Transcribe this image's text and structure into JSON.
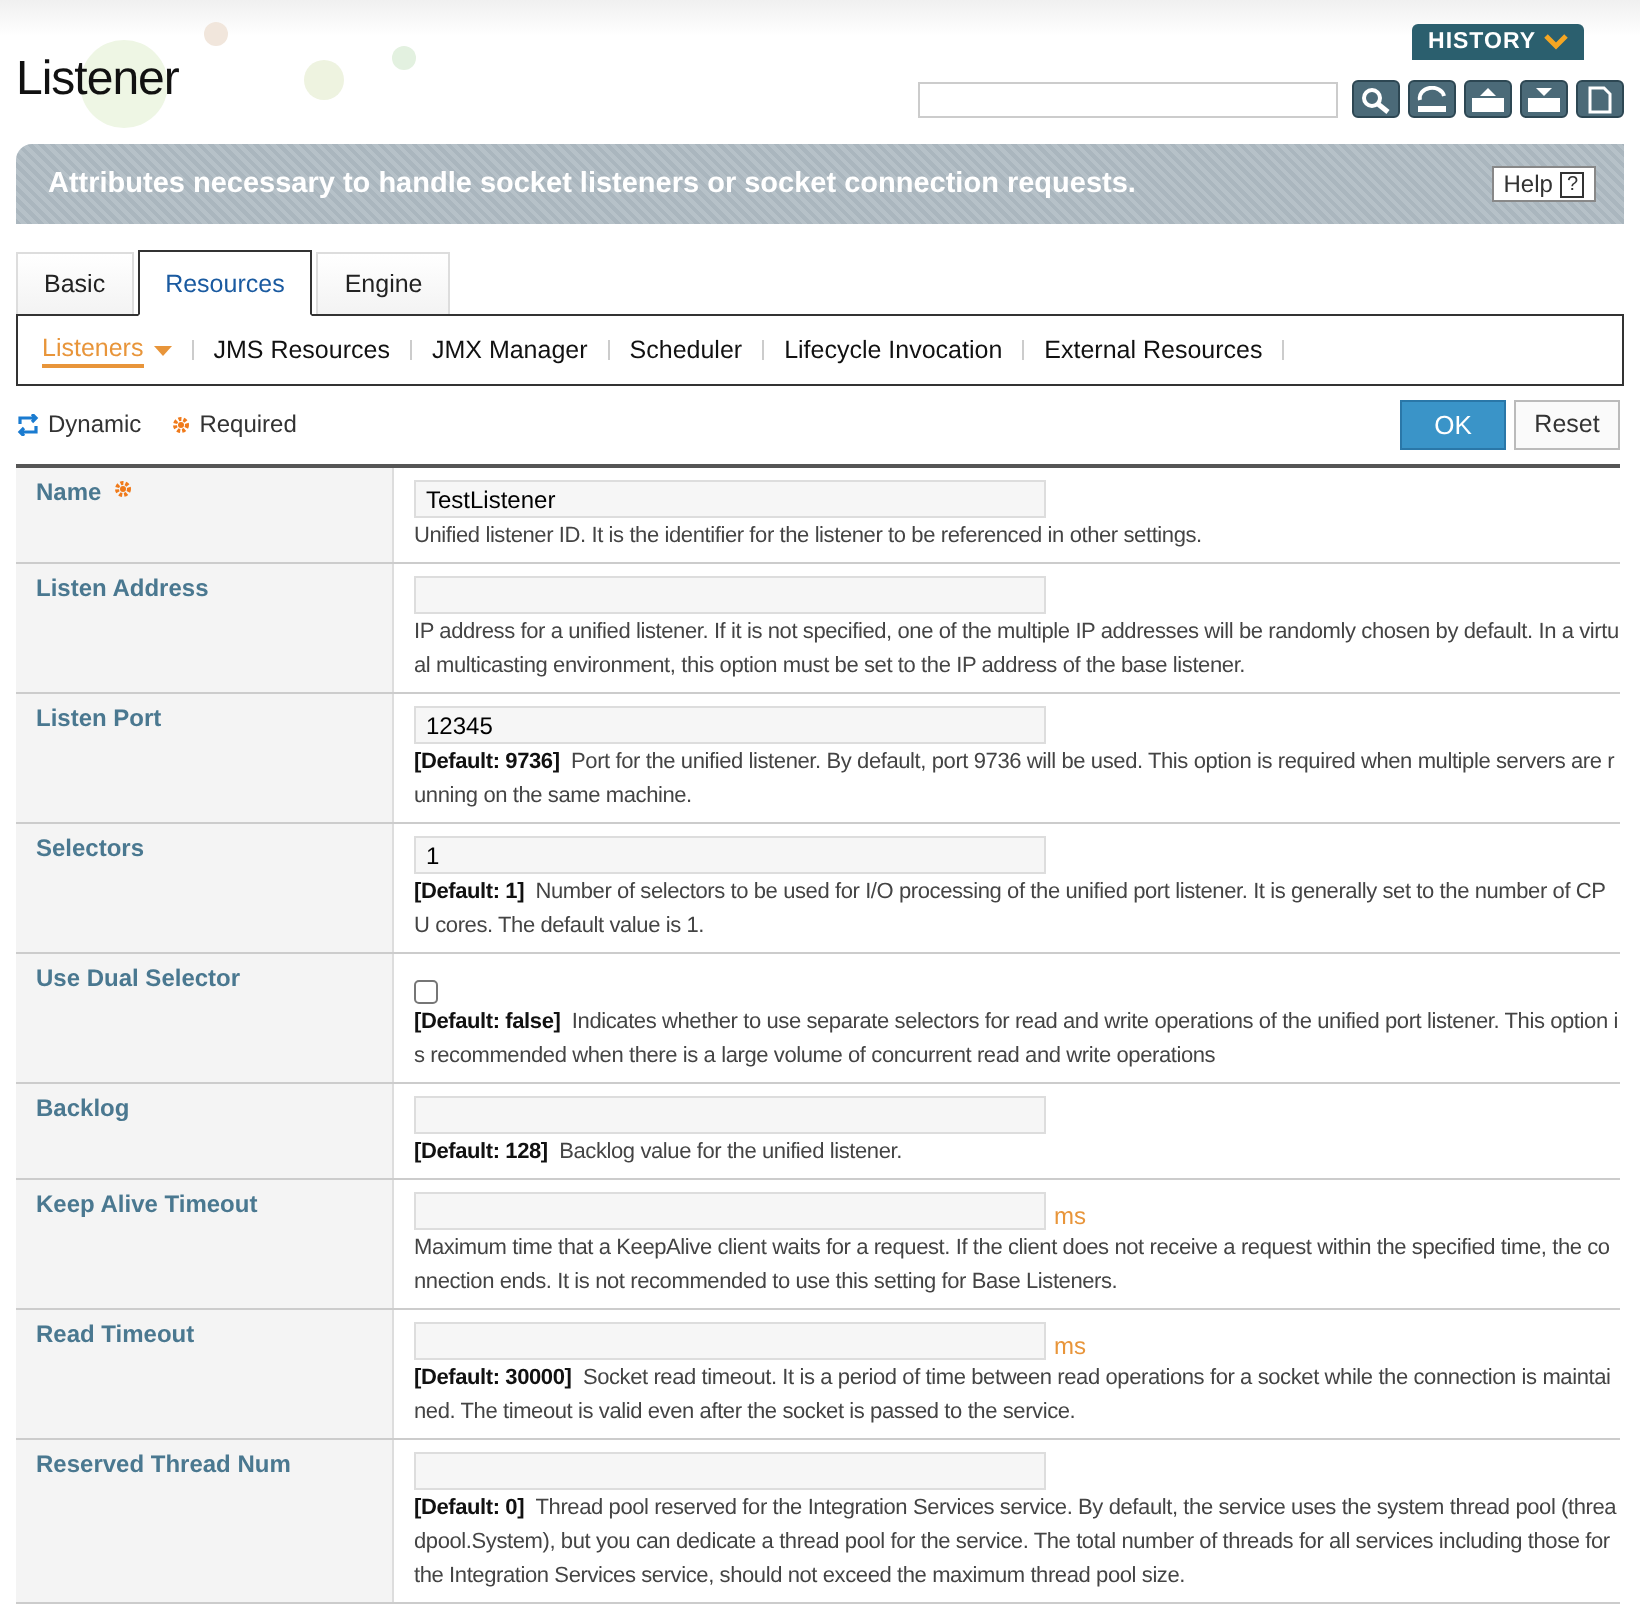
{
  "page": {
    "title": "Listener",
    "history_button": "HISTORY",
    "description": "Attributes necessary to handle socket listeners or socket connection requests.",
    "help_button": "Help",
    "help_glyph": "?"
  },
  "tabs": [
    {
      "label": "Basic",
      "selected": false
    },
    {
      "label": "Resources",
      "selected": true
    },
    {
      "label": "Engine",
      "selected": false
    }
  ],
  "subtabs": [
    {
      "label": "Listeners",
      "selected": true,
      "dropdown": true
    },
    {
      "label": "JMS Resources",
      "selected": false,
      "dropdown": false
    },
    {
      "label": "JMX Manager",
      "selected": false,
      "dropdown": false
    },
    {
      "label": "Scheduler",
      "selected": false,
      "dropdown": false
    },
    {
      "label": "Lifecycle Invocation",
      "selected": false,
      "dropdown": false
    },
    {
      "label": "External Resources",
      "selected": false,
      "dropdown": false
    }
  ],
  "legend": {
    "dynamic": "Dynamic",
    "required": "Required"
  },
  "buttons": {
    "ok": "OK",
    "reset": "Reset"
  },
  "fields": [
    {
      "label": "Name",
      "required": true,
      "kind": "text",
      "value": "TestListener",
      "description": "Unified listener ID. It is the identifier for the listener to be referenced in other settings."
    },
    {
      "label": "Listen Address",
      "required": false,
      "kind": "text",
      "description": "IP address for a unified listener. If it is not specified, one of the multiple IP addresses will be randomly chosen by default. In a virtual multicasting environment, this option must be set to the IP address of the base listener."
    },
    {
      "label": "Listen Port",
      "required": false,
      "kind": "text",
      "value": "12345",
      "default": "[Default: 9736]",
      "description": "Port for the unified listener. By default, port 9736 will be used. This option is required when multiple servers are running on the same machine."
    },
    {
      "label": "Selectors",
      "required": false,
      "kind": "text",
      "value": "1",
      "default": "[Default: 1]",
      "description": "Number of selectors to be used for I/O processing of the unified port listener. It is generally set to the number of CPU cores. The default value is 1."
    },
    {
      "label": "Use Dual Selector",
      "required": false,
      "kind": "checkbox",
      "checked": false,
      "default": "[Default: false]",
      "description": "Indicates whether to use separate selectors for read and write operations of the unified port listener. This option is recommended when there is a large volume of concurrent read and write operations"
    },
    {
      "label": "Backlog",
      "required": false,
      "kind": "text",
      "default": "[Default: 128]",
      "description": "Backlog value for the unified listener."
    },
    {
      "label": "Keep Alive Timeout",
      "required": false,
      "kind": "text",
      "unit": "ms",
      "description": "Maximum time that a KeepAlive client waits for a request. If the client does not receive a request within the specified time, the connection ends. It is not recommended to use this setting for Base Listeners."
    },
    {
      "label": "Read Timeout",
      "required": false,
      "kind": "text",
      "unit": "ms",
      "default": "[Default: 30000]",
      "description": "Socket read timeout. It is a period of time between read operations for a socket while the connection is maintained. The timeout is valid even after the socket is passed to the service."
    },
    {
      "label": "Reserved Thread Num",
      "required": false,
      "kind": "text",
      "default": "[Default: 0]",
      "description": "Thread pool reserved for the Integration Services service. By default, the service uses the system thread pool (threadpool.System), but you can dedicate a thread pool for the service. The total number of threads for all services including those for the Integration Services service, should not exceed the maximum thread pool size."
    }
  ]
}
